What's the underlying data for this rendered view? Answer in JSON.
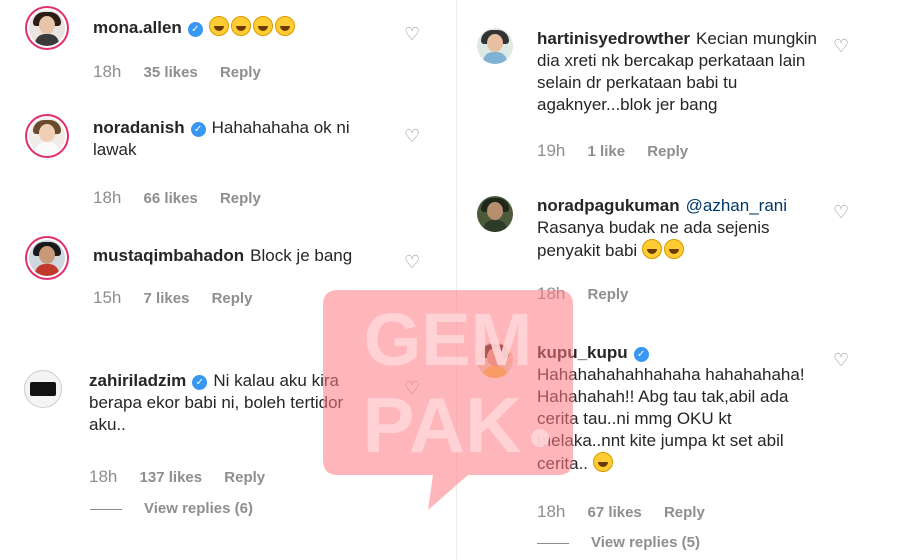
{
  "icons": {
    "heart": "♡",
    "verified": "✓"
  },
  "colors": {
    "verified": "#3897f0",
    "muted": "#8e8e8e",
    "mention": "#00376b",
    "watermark": "#ff6f7a"
  },
  "watermark": {
    "line1": "GEM",
    "line2": "PAK"
  },
  "left_comments": [
    {
      "username": "mona.allen",
      "verified": true,
      "text": "",
      "emoji_count": 4,
      "time": "18h",
      "likes": "35 likes",
      "reply": "Reply"
    },
    {
      "username": "noradanish",
      "verified": true,
      "text": "Hahahahaha ok ni lawak",
      "time": "18h",
      "likes": "66 likes",
      "reply": "Reply"
    },
    {
      "username": "mustaqimbahadon",
      "verified": false,
      "text": "Block je bang",
      "time": "15h",
      "likes": "7 likes",
      "reply": "Reply"
    },
    {
      "username": "zahiriladzim",
      "verified": true,
      "text": "Ni kalau aku kira berapa ekor babi ni, boleh tertidor aku..",
      "time": "18h",
      "likes": "137 likes",
      "reply": "Reply",
      "view_replies": "View replies (6)"
    }
  ],
  "right_comments": [
    {
      "username": "hartinisyedrowther",
      "verified": false,
      "text": "Kecian mungkin dia xreti nk bercakap perkataan lain selain dr perkataan babi tu agaknyer...blok jer bang",
      "time": "19h",
      "likes": "1 like",
      "reply": "Reply"
    },
    {
      "username": "noradpagukuman",
      "verified": false,
      "mention": "@azhan_rani",
      "text": "Rasanya budak ne ada sejenis penyakit babi",
      "time": "18h",
      "likes": "",
      "reply": "Reply"
    },
    {
      "username": "kupu_kupu",
      "verified": true,
      "text": "Hahahahahahhahaha hahahahaha! Hahahahah!! Abg tau tak,abil ada cerita tau..ni mmg OKU kt melaka..nnt kite jumpa kt set abil cerita..",
      "time": "18h",
      "likes": "67 likes",
      "reply": "Reply",
      "view_replies": "View replies (5)"
    }
  ]
}
